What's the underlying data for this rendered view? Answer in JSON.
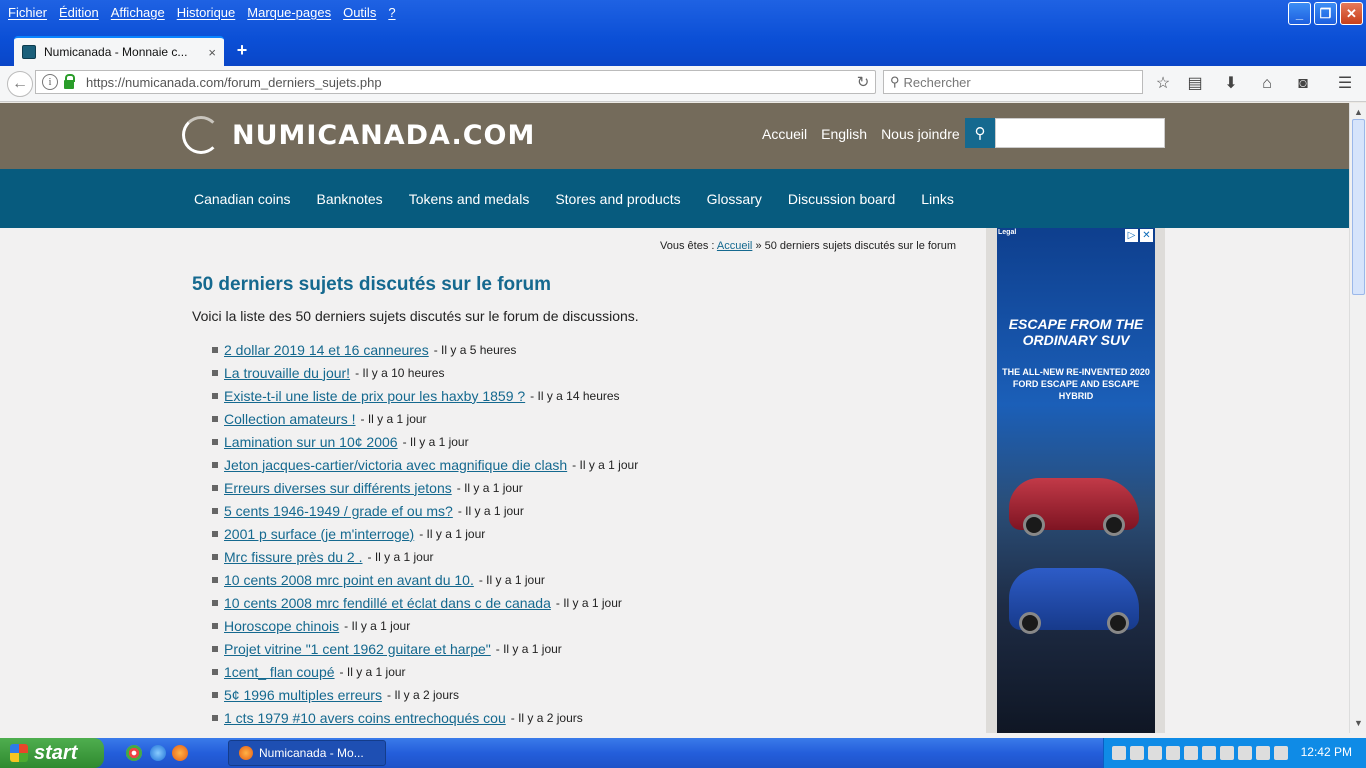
{
  "menubar": [
    "Fichier",
    "Édition",
    "Affichage",
    "Historique",
    "Marque-pages",
    "Outils",
    "?"
  ],
  "tab": {
    "title": "Numicanada - Monnaie c...",
    "close": "×"
  },
  "newtab": "+",
  "urlbar": {
    "url": "https://numicanada.com/forum_derniers_sujets.php",
    "reload": "↻"
  },
  "searchbar": {
    "placeholder": "Rechercher"
  },
  "site": {
    "logo": "NUMICANADA.COM",
    "topnav": [
      "Accueil",
      "English",
      "Nous joindre"
    ],
    "mainnav": [
      "Canadian coins",
      "Banknotes",
      "Tokens and medals",
      "Stores and products",
      "Glossary",
      "Discussion board",
      "Links"
    ]
  },
  "breadcrumb": {
    "prefix": "Vous êtes :",
    "home": "Accueil",
    "sep": "»",
    "current": "50 derniers sujets discutés sur le forum"
  },
  "page": {
    "title": "50 derniers sujets discutés sur le forum",
    "intro": "Voici la liste des 50 derniers sujets discutés sur le forum de discussions."
  },
  "topics": [
    {
      "title": "2 dollar 2019 14 et 16 canneures",
      "ago": "- Il y a 5 heures"
    },
    {
      "title": "La trouvaille du jour!",
      "ago": "- Il y a 10 heures"
    },
    {
      "title": "Existe-t-il une liste de prix pour les haxby 1859 ?",
      "ago": "- Il y a 14 heures"
    },
    {
      "title": "Collection amateurs !",
      "ago": "- Il y a 1 jour"
    },
    {
      "title": "Lamination sur un 10¢ 2006",
      "ago": "- Il y a 1 jour"
    },
    {
      "title": "Jeton jacques-cartier/victoria avec magnifique die clash",
      "ago": "- Il y a 1 jour"
    },
    {
      "title": "Erreurs diverses sur différents jetons",
      "ago": "- Il y a 1 jour"
    },
    {
      "title": "5 cents 1946-1949 / grade ef ou ms?",
      "ago": "- Il y a 1 jour"
    },
    {
      "title": "2001 p surface (je m'interroge)",
      "ago": "- Il y a 1 jour"
    },
    {
      "title": "Mrc fissure près du 2 .",
      "ago": "- Il y a 1 jour"
    },
    {
      "title": "10 cents 2008 mrc point en avant du 10.",
      "ago": "- Il y a 1 jour"
    },
    {
      "title": "10 cents 2008 mrc fendillé et éclat dans c de canada",
      "ago": "- Il y a 1 jour"
    },
    {
      "title": "Horoscope chinois",
      "ago": "- Il y a 1 jour"
    },
    {
      "title": "Projet vitrine \"1 cent 1962 guitare et harpe\"",
      "ago": "- Il y a 1 jour"
    },
    {
      "title": "1cent_ flan coupé",
      "ago": "- Il y a 1 jour"
    },
    {
      "title": "5¢ 1996 multiples erreurs",
      "ago": "- Il y a 2 jours"
    },
    {
      "title": "1 cts 1979 #10 avers coins entrechoqués cou",
      "ago": "- Il y a 2 jours"
    }
  ],
  "ad": {
    "legal": "Legal",
    "headline": "ESCAPE FROM THE ORDINARY SUV",
    "sub": "THE ALL-NEW RE-INVENTED 2020 FORD ESCAPE AND ESCAPE HYBRID"
  },
  "taskbar": {
    "start": "start",
    "item": "Numicanada - Mo...",
    "clock": "12:42 PM"
  },
  "colors": {
    "brand": "#15698f",
    "header": "#746b5b",
    "nav": "#075b7e"
  }
}
